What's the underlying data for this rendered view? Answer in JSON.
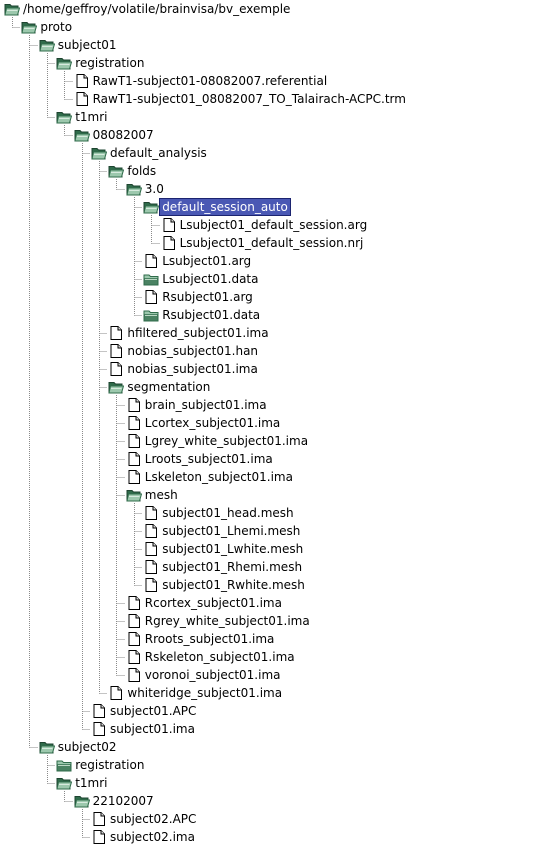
{
  "tree": {
    "rows": [
      {
        "label": "/home/geffroy/volatile/brainvisa/bv_exemple",
        "depth": 0,
        "icon": "folder-open-icon"
      },
      {
        "label": "proto",
        "depth": 1,
        "icon": "folder-open-icon"
      },
      {
        "label": "subject01",
        "depth": 2,
        "icon": "folder-open-icon"
      },
      {
        "label": "registration",
        "depth": 3,
        "icon": "folder-open-icon"
      },
      {
        "label": "RawT1-subject01-08082007.referential",
        "depth": 4,
        "icon": "file-icon"
      },
      {
        "label": "RawT1-subject01_08082007_TO_Talairach-ACPC.trm",
        "depth": 4,
        "icon": "file-icon"
      },
      {
        "label": "t1mri",
        "depth": 3,
        "icon": "folder-open-icon"
      },
      {
        "label": "08082007",
        "depth": 4,
        "icon": "folder-open-icon"
      },
      {
        "label": "default_analysis",
        "depth": 5,
        "icon": "folder-open-icon"
      },
      {
        "label": "folds",
        "depth": 6,
        "icon": "folder-open-icon"
      },
      {
        "label": "3.0",
        "depth": 7,
        "icon": "folder-open-icon"
      },
      {
        "label": "default_session_auto",
        "depth": 8,
        "icon": "folder-open-icon",
        "selected": true
      },
      {
        "label": "Lsubject01_default_session.arg",
        "depth": 9,
        "icon": "file-icon"
      },
      {
        "label": "Lsubject01_default_session.nrj",
        "depth": 9,
        "icon": "file-icon"
      },
      {
        "label": "Lsubject01.arg",
        "depth": 8,
        "icon": "file-icon"
      },
      {
        "label": "Lsubject01.data",
        "depth": 8,
        "icon": "folder-icon"
      },
      {
        "label": "Rsubject01.arg",
        "depth": 8,
        "icon": "file-icon"
      },
      {
        "label": "Rsubject01.data",
        "depth": 8,
        "icon": "folder-icon"
      },
      {
        "label": "hfiltered_subject01.ima",
        "depth": 6,
        "icon": "file-icon"
      },
      {
        "label": "nobias_subject01.han",
        "depth": 6,
        "icon": "file-icon"
      },
      {
        "label": "nobias_subject01.ima",
        "depth": 6,
        "icon": "file-icon"
      },
      {
        "label": "segmentation",
        "depth": 6,
        "icon": "folder-open-icon"
      },
      {
        "label": "brain_subject01.ima",
        "depth": 7,
        "icon": "file-icon"
      },
      {
        "label": "Lcortex_subject01.ima",
        "depth": 7,
        "icon": "file-icon"
      },
      {
        "label": "Lgrey_white_subject01.ima",
        "depth": 7,
        "icon": "file-icon"
      },
      {
        "label": "Lroots_subject01.ima",
        "depth": 7,
        "icon": "file-icon"
      },
      {
        "label": "Lskeleton_subject01.ima",
        "depth": 7,
        "icon": "file-icon"
      },
      {
        "label": "mesh",
        "depth": 7,
        "icon": "folder-open-icon"
      },
      {
        "label": "subject01_head.mesh",
        "depth": 8,
        "icon": "file-icon"
      },
      {
        "label": "subject01_Lhemi.mesh",
        "depth": 8,
        "icon": "file-icon"
      },
      {
        "label": "subject01_Lwhite.mesh",
        "depth": 8,
        "icon": "file-icon"
      },
      {
        "label": "subject01_Rhemi.mesh",
        "depth": 8,
        "icon": "file-icon"
      },
      {
        "label": "subject01_Rwhite.mesh",
        "depth": 8,
        "icon": "file-icon"
      },
      {
        "label": "Rcortex_subject01.ima",
        "depth": 7,
        "icon": "file-icon"
      },
      {
        "label": "Rgrey_white_subject01.ima",
        "depth": 7,
        "icon": "file-icon"
      },
      {
        "label": "Rroots_subject01.ima",
        "depth": 7,
        "icon": "file-icon"
      },
      {
        "label": "Rskeleton_subject01.ima",
        "depth": 7,
        "icon": "file-icon"
      },
      {
        "label": "voronoi_subject01.ima",
        "depth": 7,
        "icon": "file-icon"
      },
      {
        "label": "whiteridge_subject01.ima",
        "depth": 6,
        "icon": "file-icon"
      },
      {
        "label": "subject01.APC",
        "depth": 5,
        "icon": "file-icon"
      },
      {
        "label": "subject01.ima",
        "depth": 5,
        "icon": "file-icon"
      },
      {
        "label": "subject02",
        "depth": 2,
        "icon": "folder-open-icon"
      },
      {
        "label": "registration",
        "depth": 3,
        "icon": "folder-icon"
      },
      {
        "label": "t1mri",
        "depth": 3,
        "icon": "folder-open-icon"
      },
      {
        "label": "22102007",
        "depth": 4,
        "icon": "folder-open-icon"
      },
      {
        "label": "subject02.APC",
        "depth": 5,
        "icon": "file-icon"
      },
      {
        "label": "subject02.ima",
        "depth": 5,
        "icon": "file-icon"
      }
    ]
  },
  "colors": {
    "selection_bg": "#4a58b4",
    "selection_text": "#ffffff",
    "folder_dark": "#2f6b4a",
    "folder_light": "#9cc8ad",
    "guide_line": "#8a8a8a"
  }
}
